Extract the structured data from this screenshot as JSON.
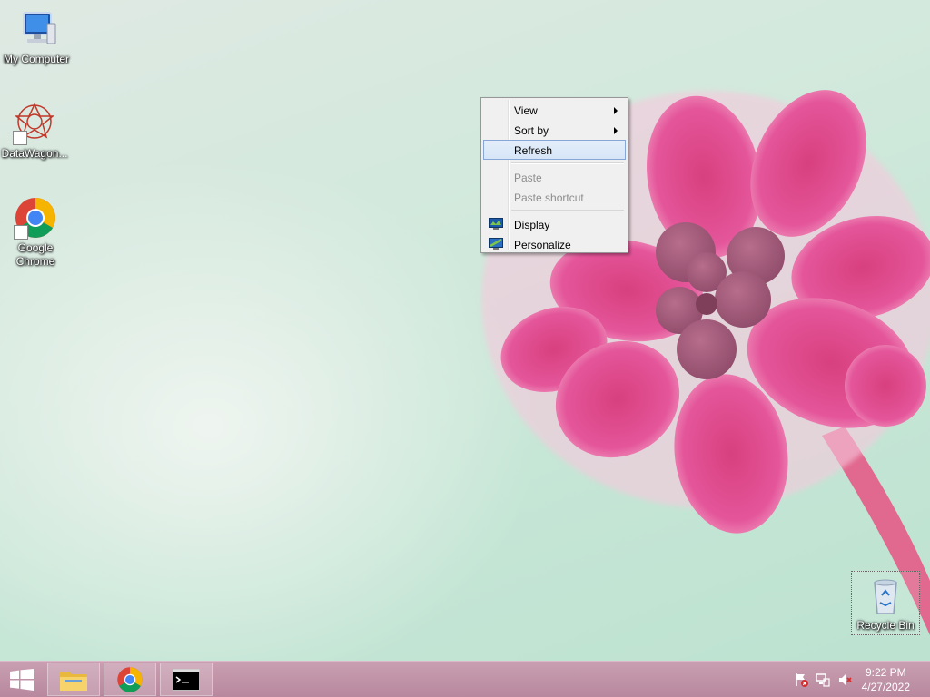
{
  "desktop": {
    "icons": [
      {
        "label": "My Computer"
      },
      {
        "label": "DataWagon..."
      },
      {
        "label": "Google Chrome"
      },
      {
        "label": "Recycle Bin"
      }
    ]
  },
  "context_menu": {
    "items": [
      {
        "label": "View",
        "submenu": true,
        "enabled": true
      },
      {
        "label": "Sort by",
        "submenu": true,
        "enabled": true
      },
      {
        "label": "Refresh",
        "enabled": true,
        "highlighted": true
      },
      {
        "label": "Paste",
        "enabled": false
      },
      {
        "label": "Paste shortcut",
        "enabled": false
      },
      {
        "label": "Display",
        "enabled": true,
        "icon": "display-icon"
      },
      {
        "label": "Personalize",
        "enabled": true,
        "icon": "personalize-icon"
      }
    ]
  },
  "taskbar": {
    "apps": [
      {
        "name": "File Explorer",
        "icon": "folder-icon"
      },
      {
        "name": "Google Chrome",
        "icon": "chrome-icon"
      },
      {
        "name": "Command Prompt",
        "icon": "cmd-icon"
      }
    ],
    "tray": {
      "time": "9:22 PM",
      "date": "4/27/2022"
    }
  },
  "colors": {
    "taskbar": "#bd8fa4",
    "menu_highlight": "#d6e5f7",
    "flower": "#e0488a"
  }
}
